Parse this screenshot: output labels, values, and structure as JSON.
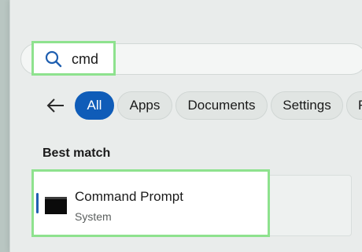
{
  "search": {
    "query": "cmd",
    "icon": "search-icon"
  },
  "filters": [
    {
      "label": "All",
      "active": true
    },
    {
      "label": "Apps",
      "active": false
    },
    {
      "label": "Documents",
      "active": false
    },
    {
      "label": "Settings",
      "active": false
    },
    {
      "label": "F",
      "active": false
    }
  ],
  "best_match": {
    "heading": "Best match",
    "title": "Command Prompt",
    "subtitle": "System"
  },
  "colors": {
    "accent": "#0f5cb8",
    "highlight": "#8ee28e"
  }
}
